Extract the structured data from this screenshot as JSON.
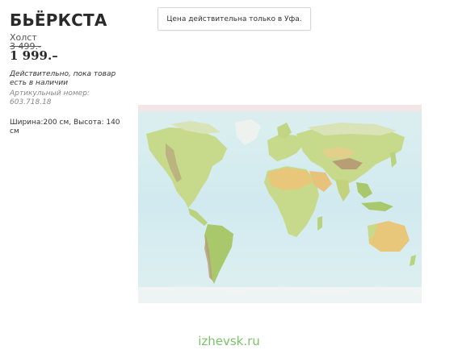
{
  "product": {
    "title": "БЬЁРКСТА",
    "type": "Холст",
    "old_price": "3 499.-",
    "new_price": "1 999.–",
    "availability": "Действительно, пока товар есть в наличии",
    "article": "Артикульный номер: 603.718.18",
    "dimensions": "Ширина:200 см, Высота: 140 см"
  },
  "price_note": "Цена действительна только в Уфа.",
  "watermark": "izhevsk.ru",
  "colors": {
    "ocean": "#d4ecef",
    "land": "#c7d98a",
    "desert": "#e8c77a",
    "mountain": "#b79e77",
    "ice": "#f3f6f6",
    "watermark": "#7cc26a"
  },
  "image": {
    "subject": "world-map-canvas"
  }
}
